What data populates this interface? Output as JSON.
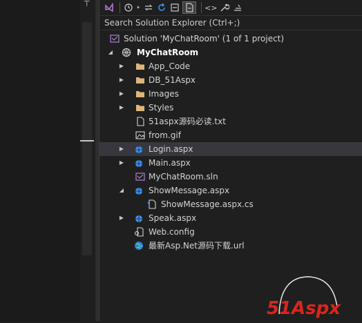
{
  "toolbar": {
    "buttons": [
      "vs-icon",
      "history-icon",
      "sync-arrows-icon",
      "refresh-icon",
      "collapse-icon",
      "show-all-files-icon",
      "code-icon",
      "wrench-icon",
      "properties-icon"
    ]
  },
  "search": {
    "placeholder": "Search Solution Explorer (Ctrl+;)"
  },
  "tree": {
    "solution": "Solution 'MyChatRoom' (1 of 1 project)",
    "project": "MyChatRoom",
    "items": [
      {
        "label": "App_Code",
        "type": "folder"
      },
      {
        "label": "DB_51Aspx",
        "type": "folder"
      },
      {
        "label": "Images",
        "type": "folder"
      },
      {
        "label": "Styles",
        "type": "folder"
      },
      {
        "label": "51aspx源码必读.txt",
        "type": "file"
      },
      {
        "label": "from.gif",
        "type": "image"
      },
      {
        "label": "Login.aspx",
        "type": "web"
      },
      {
        "label": "Main.aspx",
        "type": "web"
      },
      {
        "label": "MyChatRoom.sln",
        "type": "sln"
      },
      {
        "label": "ShowMessage.aspx",
        "type": "web"
      },
      {
        "label": "ShowMessage.aspx.cs",
        "type": "cs"
      },
      {
        "label": "Speak.aspx",
        "type": "web"
      },
      {
        "label": "Web.config",
        "type": "config"
      },
      {
        "label": "最新Asp.Net源码下载.url",
        "type": "url"
      }
    ]
  },
  "watermark": {
    "brand": "51Aspx"
  }
}
